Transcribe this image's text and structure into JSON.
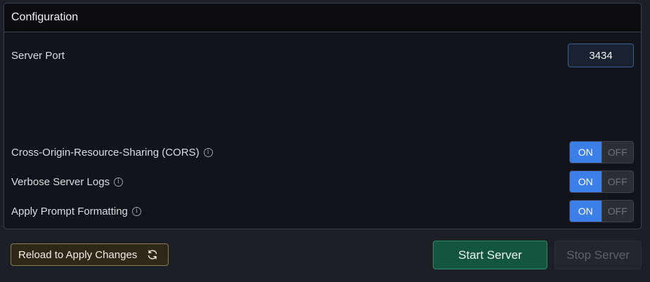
{
  "panel": {
    "title": "Configuration"
  },
  "server_port": {
    "label": "Server Port",
    "value": "3434"
  },
  "toggles": [
    {
      "label": "Cross-Origin-Resource-Sharing (CORS)",
      "on_label": "ON",
      "off_label": "OFF",
      "state": "on"
    },
    {
      "label": "Verbose Server Logs",
      "on_label": "ON",
      "off_label": "OFF",
      "state": "on"
    },
    {
      "label": "Apply Prompt Formatting",
      "on_label": "ON",
      "off_label": "OFF",
      "state": "on"
    }
  ],
  "info_icon": "i",
  "buttons": {
    "reload": "Reload to Apply Changes",
    "start": "Start Server",
    "stop": "Stop Server"
  },
  "colors": {
    "toggle_on": "#3d7fe9",
    "start_button": "#14553f",
    "reload_button_border": "#8a7a4f"
  },
  "icons": {
    "reload": "refresh-icon",
    "info": "info-icon"
  }
}
